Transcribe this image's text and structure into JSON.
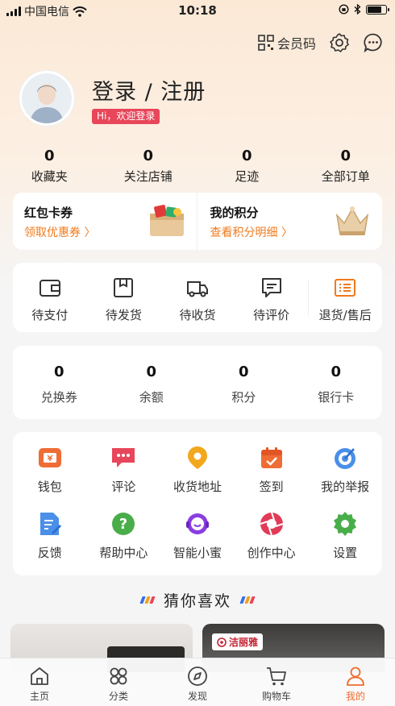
{
  "status_bar": {
    "carrier": "中国电信",
    "time": "10:18"
  },
  "header": {
    "member_code_label": "会员码",
    "login_title": "登录 / 注册",
    "welcome_badge": "Hi，欢迎登录"
  },
  "stats": [
    {
      "value": "0",
      "label": "收藏夹"
    },
    {
      "value": "0",
      "label": "关注店铺"
    },
    {
      "value": "0",
      "label": "足迹"
    },
    {
      "value": "0",
      "label": "全部订单"
    }
  ],
  "promo": {
    "coupon": {
      "title": "红包卡券",
      "sub": "领取优惠券 〉"
    },
    "points": {
      "title": "我的积分",
      "sub": "查看积分明细 〉"
    }
  },
  "orders": [
    {
      "label": "待支付",
      "icon": "wallet-icon"
    },
    {
      "label": "待发货",
      "icon": "box-icon"
    },
    {
      "label": "待收货",
      "icon": "truck-icon"
    },
    {
      "label": "待评价",
      "icon": "comment-icon"
    },
    {
      "label": "退货/售后",
      "icon": "return-list-icon"
    }
  ],
  "balance": [
    {
      "value": "0",
      "label": "兑换券"
    },
    {
      "value": "0",
      "label": "余额"
    },
    {
      "value": "0",
      "label": "积分"
    },
    {
      "value": "0",
      "label": "银行卡"
    }
  ],
  "services": [
    {
      "label": "钱包",
      "icon": "wallet-icon"
    },
    {
      "label": "评论",
      "icon": "chat-bubble-icon"
    },
    {
      "label": "收货地址",
      "icon": "location-pin-icon"
    },
    {
      "label": "签到",
      "icon": "calendar-check-icon"
    },
    {
      "label": "我的举报",
      "icon": "target-icon"
    },
    {
      "label": "反馈",
      "icon": "document-edit-icon"
    },
    {
      "label": "帮助中心",
      "icon": "question-icon"
    },
    {
      "label": "智能小蜜",
      "icon": "headset-icon"
    },
    {
      "label": "创作中心",
      "icon": "aperture-icon"
    },
    {
      "label": "设置",
      "icon": "gear-icon"
    }
  ],
  "guess_title": "猜你喜欢",
  "product_brand": "洁丽雅",
  "tabs": [
    {
      "label": "主页",
      "icon": "home-icon"
    },
    {
      "label": "分类",
      "icon": "grid-icon"
    },
    {
      "label": "发现",
      "icon": "compass-icon"
    },
    {
      "label": "购物车",
      "icon": "cart-icon"
    },
    {
      "label": "我的",
      "icon": "person-icon"
    }
  ],
  "colors": {
    "accent": "#f06a2a",
    "badge": "#e8465a",
    "promo_link": "#f07a1c"
  }
}
